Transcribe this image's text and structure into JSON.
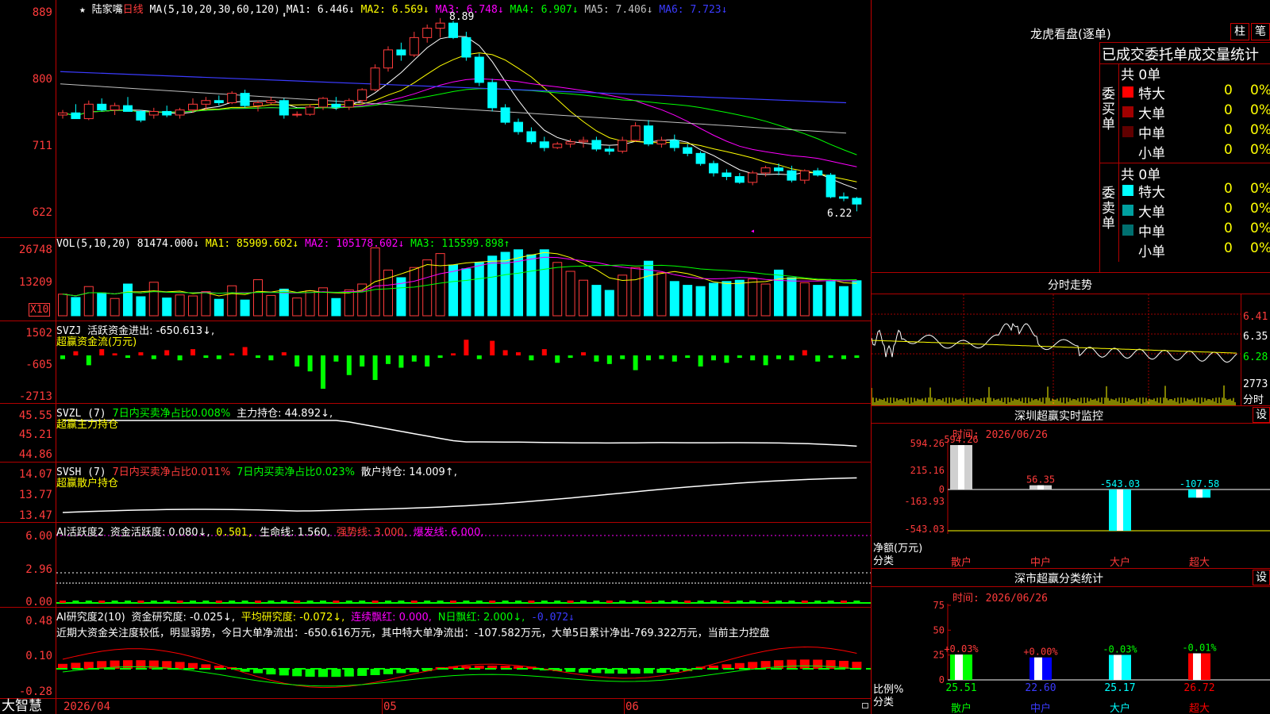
{
  "chart_header": {
    "star": "★",
    "name": "陆家嘴",
    "period": "日线",
    "ma_params": "MA(5,10,20,30,60,120)",
    "ma1": "MA1: 6.446↓",
    "ma2": "MA2: 6.569↓",
    "ma3": "MA3: 6.748↓",
    "ma4": "MA4: 6.907↓",
    "ma5": "MA5: 7.406↓",
    "ma6": "MA6: 7.723↓"
  },
  "price_axis": [
    "889",
    "800",
    "711",
    "622"
  ],
  "price_annotations": {
    "high": "8.89",
    "low": "6.22"
  },
  "vol_header": {
    "label": "VOL(5,10,20)",
    "vol": "81474.000↓",
    "ma1": "MA1: 85909.602↓",
    "ma2": "MA2: 105178.602↓",
    "ma3": "MA3: 115599.898↑"
  },
  "vol_axis": [
    "26748",
    "13209"
  ],
  "vol_unit": "X10",
  "svzj": {
    "label": "SVZJ",
    "text": "活跃资金进出: -650.613↓,",
    "sub": "超赢资金流(万元)",
    "axis": [
      "1502",
      "-605",
      "-2713"
    ]
  },
  "svzl": {
    "label": "SVZL (7)",
    "t1": "7日内买卖净占比0.008%",
    "t2": "主力持仓: 44.892↓,",
    "sub": "超赢主力持仓",
    "axis": [
      "45.55",
      "45.21",
      "44.86"
    ]
  },
  "svsh": {
    "label": "SVSH (7)",
    "t1": "7日内买卖净占比0.011%",
    "t2": "7日内买卖净占比0.023%",
    "t3": "散户持仓: 14.009↑,",
    "sub": "超赢散户持仓",
    "axis": [
      "14.07",
      "13.77",
      "13.47"
    ]
  },
  "ai_active": {
    "label": "AI活跃度2",
    "t1": "资金活跃度: 0.080↓,",
    "t2": "0.501,",
    "t3": "生命线: 1.560,",
    "t4": "强势线: 3.000,",
    "t5": "爆发线: 6.000,",
    "axis": [
      "6.00",
      "2.96",
      "0.00"
    ]
  },
  "ai_research": {
    "label": "AI研究度2(10)",
    "t1": "资金研究度: -0.025↓,",
    "t2": "平均研究度: -0.072↓,",
    "t3": "连续飘红: 0.000,",
    "t4": "N日飘红: 2.000↓,",
    "t5": "-0.072↓",
    "comment": "近期大资金关注度较低，明显弱势，今日大单净流出：-650.616万元，其中特大单净流出：-107.582万元，大单5日累计净出-769.322万元，当前主力控盘",
    "axis": [
      "0.48",
      "0.10",
      "-0.28"
    ]
  },
  "date_axis": {
    "d1": "2026/04",
    "d2": "05",
    "d3": "06"
  },
  "logo": "大智慧",
  "dragon": {
    "title": "龙虎看盘(逐单)",
    "btn1": "柱",
    "btn2": "笔",
    "subtitle": "已成交委托单成交量统计",
    "buy_label": "委买单",
    "sell_label": "委卖单",
    "buy_total": "共 0单",
    "sell_total": "共 0单",
    "buy_rows": [
      {
        "name": "特大",
        "count": "0",
        "pct": "0%",
        "color": "#ff0000"
      },
      {
        "name": "大单",
        "count": "0",
        "pct": "0%",
        "color": "#a00000"
      },
      {
        "name": "中单",
        "count": "0",
        "pct": "0%",
        "color": "#600000"
      },
      {
        "name": "小单",
        "count": "0",
        "pct": "0%",
        "color": ""
      }
    ],
    "sell_rows": [
      {
        "name": "特大",
        "count": "0",
        "pct": "0%",
        "color": "#00ffff"
      },
      {
        "name": "大单",
        "count": "0",
        "pct": "0%",
        "color": "#00a0a0"
      },
      {
        "name": "中单",
        "count": "0",
        "pct": "0%",
        "color": "#007070"
      },
      {
        "name": "小单",
        "count": "0",
        "pct": "0%",
        "color": ""
      }
    ]
  },
  "intraday": {
    "title": "分时走势",
    "axis": [
      "6.41",
      "6.35",
      "6.28"
    ],
    "vol": "2773",
    "vol_label": "分时"
  },
  "sz_monitor": {
    "title": "深圳超赢实时监控",
    "btn": "设",
    "date": "时间: 2026/06/26",
    "axis": [
      "594.26",
      "215.16",
      "0",
      "-163.93",
      "-543.03"
    ],
    "ylabel1": "净额(万元)",
    "ylabel2": "分类",
    "bars": [
      {
        "name": "散户",
        "value": 594.26,
        "label": "594.26"
      },
      {
        "name": "中户",
        "value": 56.35,
        "label": "56.35"
      },
      {
        "name": "大户",
        "value": -543.03,
        "label": "-543.03"
      },
      {
        "name": "超大",
        "value": -107.58,
        "label": "-107.58"
      }
    ]
  },
  "sz_stats": {
    "title": "深市超赢分类统计",
    "btn": "设",
    "date": "时间: 2026/06/26",
    "axis": [
      "75",
      "50",
      "25",
      "0"
    ],
    "ylabel1": "比例%",
    "ylabel2": "分类",
    "bars": [
      {
        "name": "散户",
        "value": 25.51,
        "label": "25.51",
        "chg": "+0.03%",
        "color": "#00ff00"
      },
      {
        "name": "中户",
        "value": 22.6,
        "label": "22.60",
        "chg": "+0.00%",
        "color": "#0000ff"
      },
      {
        "name": "大户",
        "value": 25.17,
        "label": "25.17",
        "chg": "-0.03%",
        "color": "#00ffff"
      },
      {
        "name": "超大",
        "value": 26.72,
        "label": "26.72",
        "chg": "-0.01%",
        "color": "#ff0000"
      }
    ]
  },
  "chart_data": {
    "type": "candlestick",
    "title": "陆家嘴 日线",
    "ylim": [
      6.22,
      8.89
    ],
    "ohlc": [
      [
        7.55,
        7.62,
        7.5,
        7.58
      ],
      [
        7.58,
        7.7,
        7.52,
        7.5
      ],
      [
        7.5,
        7.75,
        7.48,
        7.7
      ],
      [
        7.7,
        7.78,
        7.6,
        7.62
      ],
      [
        7.62,
        7.72,
        7.55,
        7.68
      ],
      [
        7.68,
        7.8,
        7.62,
        7.6
      ],
      [
        7.6,
        7.62,
        7.45,
        7.48
      ],
      [
        7.55,
        7.65,
        7.5,
        7.6
      ],
      [
        7.6,
        7.68,
        7.52,
        7.55
      ],
      [
        7.55,
        7.65,
        7.5,
        7.62
      ],
      [
        7.62,
        7.78,
        7.58,
        7.7
      ],
      [
        7.7,
        7.8,
        7.62,
        7.75
      ],
      [
        7.75,
        7.82,
        7.68,
        7.72
      ],
      [
        7.72,
        7.88,
        7.7,
        7.85
      ],
      [
        7.85,
        7.9,
        7.65,
        7.68
      ],
      [
        7.68,
        7.75,
        7.6,
        7.72
      ],
      [
        7.72,
        7.8,
        7.7,
        7.75
      ],
      [
        7.75,
        7.78,
        7.5,
        7.55
      ],
      [
        7.55,
        7.6,
        7.52,
        7.56
      ],
      [
        7.56,
        7.7,
        7.54,
        7.66
      ],
      [
        7.66,
        7.8,
        7.62,
        7.78
      ],
      [
        7.7,
        7.8,
        7.62,
        7.66
      ],
      [
        7.66,
        7.78,
        7.62,
        7.75
      ],
      [
        7.75,
        7.92,
        7.7,
        7.9
      ],
      [
        7.9,
        8.25,
        7.88,
        8.2
      ],
      [
        8.2,
        8.5,
        8.15,
        8.45
      ],
      [
        8.45,
        8.55,
        8.3,
        8.38
      ],
      [
        8.38,
        8.7,
        8.35,
        8.62
      ],
      [
        8.62,
        8.8,
        8.55,
        8.75
      ],
      [
        8.75,
        8.89,
        8.62,
        8.82
      ],
      [
        8.82,
        8.85,
        8.6,
        8.62
      ],
      [
        8.62,
        8.7,
        8.3,
        8.35
      ],
      [
        8.35,
        8.4,
        7.95,
        8.0
      ],
      [
        8.0,
        8.05,
        7.6,
        7.65
      ],
      [
        7.65,
        7.7,
        7.42,
        7.45
      ],
      [
        7.45,
        7.5,
        7.28,
        7.32
      ],
      [
        7.32,
        7.38,
        7.15,
        7.18
      ],
      [
        7.18,
        7.25,
        7.05,
        7.1
      ],
      [
        7.1,
        7.18,
        7.08,
        7.15
      ],
      [
        7.15,
        7.22,
        7.1,
        7.18
      ],
      [
        7.18,
        7.25,
        7.1,
        7.2
      ],
      [
        7.2,
        7.25,
        7.05,
        7.08
      ],
      [
        7.08,
        7.12,
        7.0,
        7.05
      ],
      [
        7.05,
        7.25,
        7.02,
        7.2
      ],
      [
        7.2,
        7.45,
        7.18,
        7.4
      ],
      [
        7.4,
        7.48,
        7.12,
        7.15
      ],
      [
        7.15,
        7.25,
        7.1,
        7.2
      ],
      [
        7.2,
        7.28,
        7.05,
        7.1
      ],
      [
        7.1,
        7.15,
        6.98,
        7.02
      ],
      [
        7.02,
        7.05,
        6.85,
        6.88
      ],
      [
        6.88,
        6.92,
        6.7,
        6.75
      ],
      [
        6.75,
        6.8,
        6.65,
        6.7
      ],
      [
        6.7,
        6.75,
        6.6,
        6.62
      ],
      [
        6.62,
        6.78,
        6.58,
        6.75
      ],
      [
        6.75,
        6.85,
        6.7,
        6.82
      ],
      [
        6.82,
        6.88,
        6.72,
        6.78
      ],
      [
        6.78,
        6.85,
        6.62,
        6.65
      ],
      [
        6.65,
        6.8,
        6.6,
        6.78
      ],
      [
        6.78,
        6.82,
        6.7,
        6.72
      ],
      [
        6.72,
        6.75,
        6.4,
        6.42
      ],
      [
        6.42,
        6.48,
        6.36,
        6.4
      ],
      [
        6.4,
        6.42,
        6.22,
        6.32
      ]
    ],
    "volume": [
      8500,
      7200,
      11500,
      9000,
      6800,
      12500,
      7500,
      13200,
      7000,
      8200,
      7800,
      9500,
      6500,
      11800,
      6200,
      14200,
      8000,
      10500,
      7000,
      9800,
      11000,
      6800,
      10200,
      12500,
      26748,
      18000,
      15000,
      19000,
      22000,
      24500,
      20000,
      18500,
      21000,
      23500,
      25000,
      26000,
      24000,
      26000,
      21000,
      17500,
      14000,
      12000,
      10000,
      16000,
      19000,
      21500,
      17000,
      13500,
      12000,
      11500,
      12800,
      13500,
      14000,
      14500,
      12500,
      18000,
      15000,
      13000,
      12000,
      13500,
      11500,
      13800,
      12000,
      11000,
      12600
    ],
    "svzj": [
      -300,
      400,
      -800,
      600,
      200,
      -200,
      300,
      -300,
      500,
      -400,
      600,
      -200,
      -300,
      200,
      800,
      -200,
      -400,
      300,
      -900,
      -1300,
      -2713,
      -500,
      -1600,
      -900,
      -2000,
      -700,
      -1000,
      -500,
      -900,
      -200,
      200,
      1502,
      -300,
      1400,
      500,
      300,
      -400,
      600,
      -600,
      -200,
      300,
      -500,
      -700,
      -300,
      -1200,
      -400,
      -300,
      -500,
      -200,
      -900,
      -400,
      -600,
      -200,
      -400,
      -800,
      -300,
      -400,
      500,
      -500,
      -200,
      -300,
      -200,
      -650
    ]
  }
}
